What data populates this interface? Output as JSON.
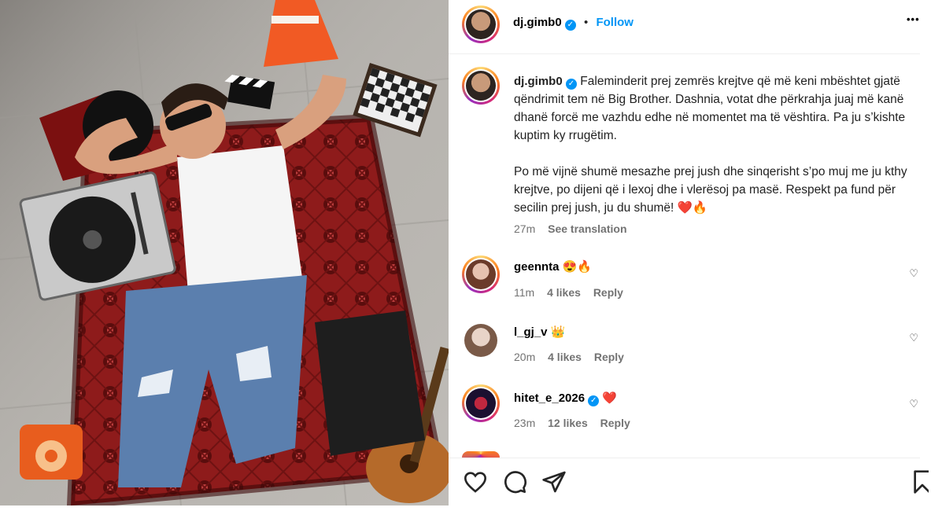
{
  "post": {
    "username": "dj.gimb0",
    "follow_label": "Follow",
    "separator": "•",
    "more_label": "•••"
  },
  "caption": {
    "username": "dj.gimb0",
    "paragraph1": "Faleminderit prej zemrës krejtve që më keni mbështet gjatë qëndrimit tem në Big Brother. Dashnia, votat dhe përkrahja juaj më kanë dhanë forcë me vazhdu edhe në momentet ma të vështira. Pa ju s’kishte kuptim ky rrugëtim.",
    "paragraph2": "Po më vijnë shumë mesazhe prej jush dhe sinqerisht s’po muj me ju kthy krejtve, po dijeni që i lexoj dhe i vlerësoj pa masë. Respekt pa fund për secilin prej jush, ju du shumë! ❤️🔥",
    "time": "27m",
    "see_translation": "See translation"
  },
  "comments": [
    {
      "username": "geennta",
      "text": "😍🔥",
      "time": "11m",
      "likes": "4 likes",
      "reply": "Reply"
    },
    {
      "username": "l_gj_v",
      "text": "👑",
      "time": "20m",
      "likes": "4 likes",
      "reply": "Reply"
    },
    {
      "username": "hitet_e_2026",
      "text": "❤️",
      "time": "23m",
      "likes": "12 likes",
      "reply": "Reply"
    }
  ],
  "colors": {
    "accent": "#0095f6",
    "muted": "#737373",
    "verified": "#0095f6",
    "carpet": "#8e1b1b",
    "cone": "#f15a24"
  },
  "icons": [
    "like-icon",
    "comment-icon",
    "share-icon",
    "save-icon",
    "more-icon",
    "verified-badge-icon"
  ]
}
